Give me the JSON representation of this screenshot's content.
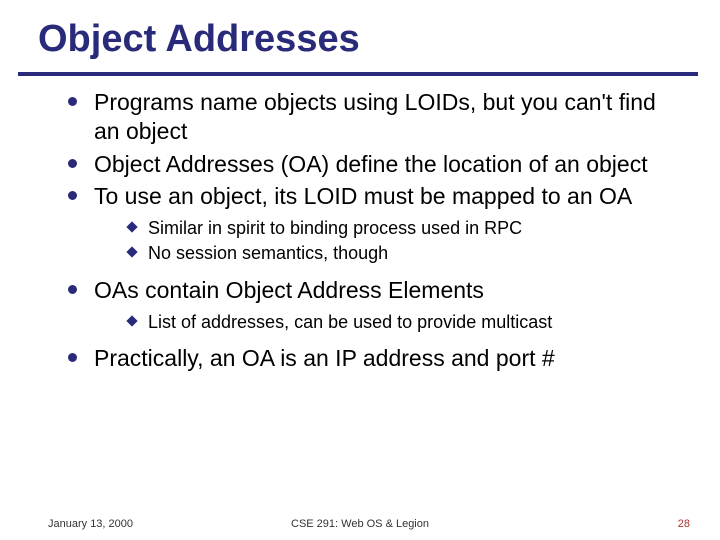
{
  "title": "Object Addresses",
  "bullets": {
    "b1": "Programs name objects using LOIDs, but you can't find an object",
    "b2": "Object Addresses (OA) define the location of an object",
    "b3": "To use an object, its LOID must be mapped to an OA",
    "b3_sub1": "Similar in spirit to binding process used in RPC",
    "b3_sub2": "No session semantics, though",
    "b4": "OAs contain Object Address Elements",
    "b4_sub1": "List of addresses, can be used to provide multicast",
    "b5": "Practically, an OA is an IP address and port #"
  },
  "footer": {
    "date": "January 13, 2000",
    "center": "CSE 291: Web OS & Legion",
    "page": "28"
  }
}
